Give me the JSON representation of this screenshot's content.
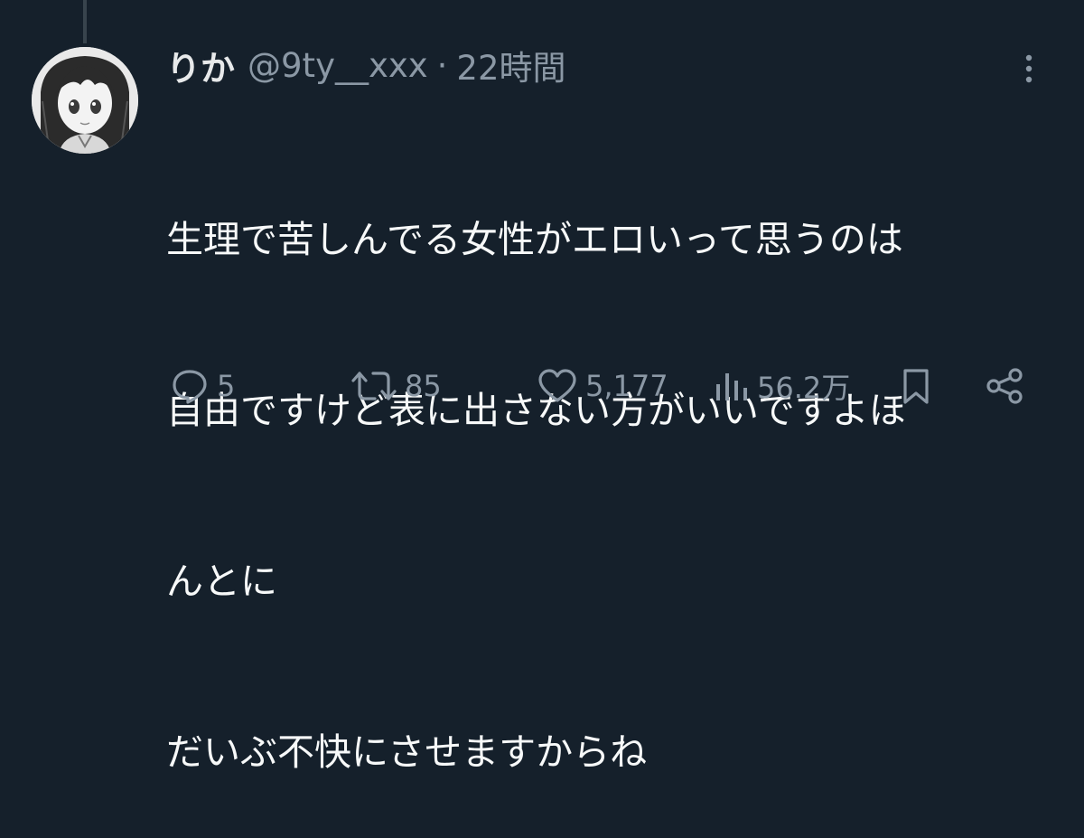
{
  "tweet": {
    "author": {
      "display_name": "りか",
      "handle": "@9ty__xxx"
    },
    "separator": "·",
    "timestamp": "22時間",
    "text_lines": [
      "生理で苦しんでる女性がエロいって思うのは",
      "自由ですけど表に出さない方がいいですよほ",
      "んとに",
      "だいぶ不快にさせますからね"
    ]
  },
  "actions": {
    "reply": {
      "icon": "reply-icon",
      "count": "5"
    },
    "retweet": {
      "icon": "retweet-icon",
      "count": "85"
    },
    "like": {
      "icon": "heart-icon",
      "count": "5,177"
    },
    "views": {
      "icon": "views-icon",
      "count": "56.2万"
    },
    "bookmark": {
      "icon": "bookmark-icon"
    },
    "share": {
      "icon": "share-icon"
    }
  },
  "colors": {
    "background": "#15202b",
    "text": "#e7e9ea",
    "secondary_text": "#8b98a5",
    "thread_line": "#38444d"
  }
}
